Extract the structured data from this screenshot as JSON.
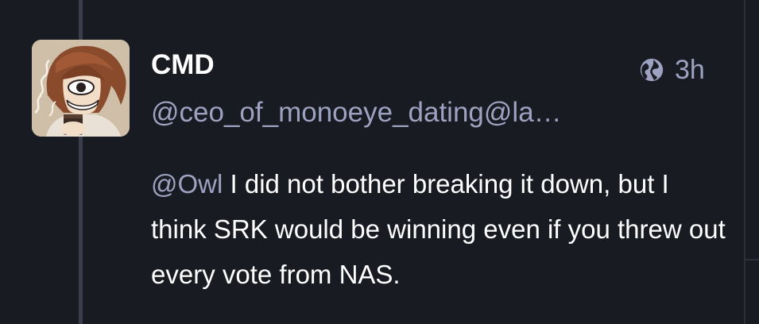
{
  "status": {
    "author": {
      "display_name": "CMD",
      "handle": "@ceo_of_monoeye_dating@la…",
      "avatar_description": "avatar"
    },
    "visibility_icon": "globe-icon",
    "timestamp": "3h",
    "content": {
      "mention": "@Owl",
      "text": " I did not bother breaking it down, but I think SRK would be winning even if you threw out every vote from NAS."
    }
  },
  "colors": {
    "background": "#191b22",
    "thread_line": "#3b3d4d",
    "secondary_text": "#9ca2c0",
    "primary_text": "#ffffff"
  }
}
